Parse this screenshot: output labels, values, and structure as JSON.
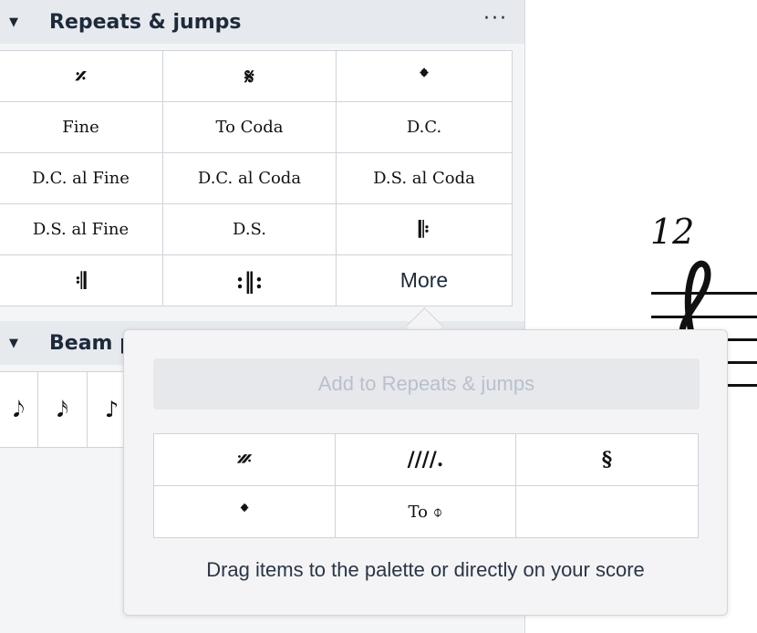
{
  "repeats": {
    "title": "Repeats & jumps",
    "menu_dots": "···",
    "cells": [
      {
        "label": "𝄎",
        "kind": "sym"
      },
      {
        "label": "𝄋",
        "kind": "sym"
      },
      {
        "label": "𝄌",
        "kind": "sym"
      },
      {
        "label": "Fine",
        "kind": "txt"
      },
      {
        "label": "To Coda",
        "kind": "txt"
      },
      {
        "label": "D.C.",
        "kind": "txt"
      },
      {
        "label": "D.C. al Fine",
        "kind": "txt"
      },
      {
        "label": "D.C. al Coda",
        "kind": "txt"
      },
      {
        "label": "D.S. al Coda",
        "kind": "txt"
      },
      {
        "label": "D.S. al Fine",
        "kind": "txt"
      },
      {
        "label": "D.S.",
        "kind": "txt"
      },
      {
        "label": "𝄆",
        "kind": "sym"
      },
      {
        "label": "𝄇",
        "kind": "sym"
      },
      {
        "label": ":‖:",
        "kind": "sym"
      },
      {
        "label": "More",
        "kind": "more"
      }
    ]
  },
  "beam": {
    "title": "Beam p",
    "cells": [
      "𝅘𝅥𝅮",
      "𝅘𝅥𝅯",
      "♪"
    ]
  },
  "score": {
    "measure_number": "12"
  },
  "popup": {
    "add_button": "Add to Repeats & jumps",
    "items": [
      {
        "label": "𝄏",
        "kind": "sym"
      },
      {
        "label": "////.",
        "kind": "sym"
      },
      {
        "label": "§",
        "kind": "sym"
      },
      {
        "label": "𝄌",
        "kind": "sym"
      },
      {
        "label": "To ⌽",
        "kind": "txt"
      },
      {
        "label": "",
        "kind": "empty"
      }
    ],
    "hint": "Drag items to the palette or directly on your score"
  }
}
